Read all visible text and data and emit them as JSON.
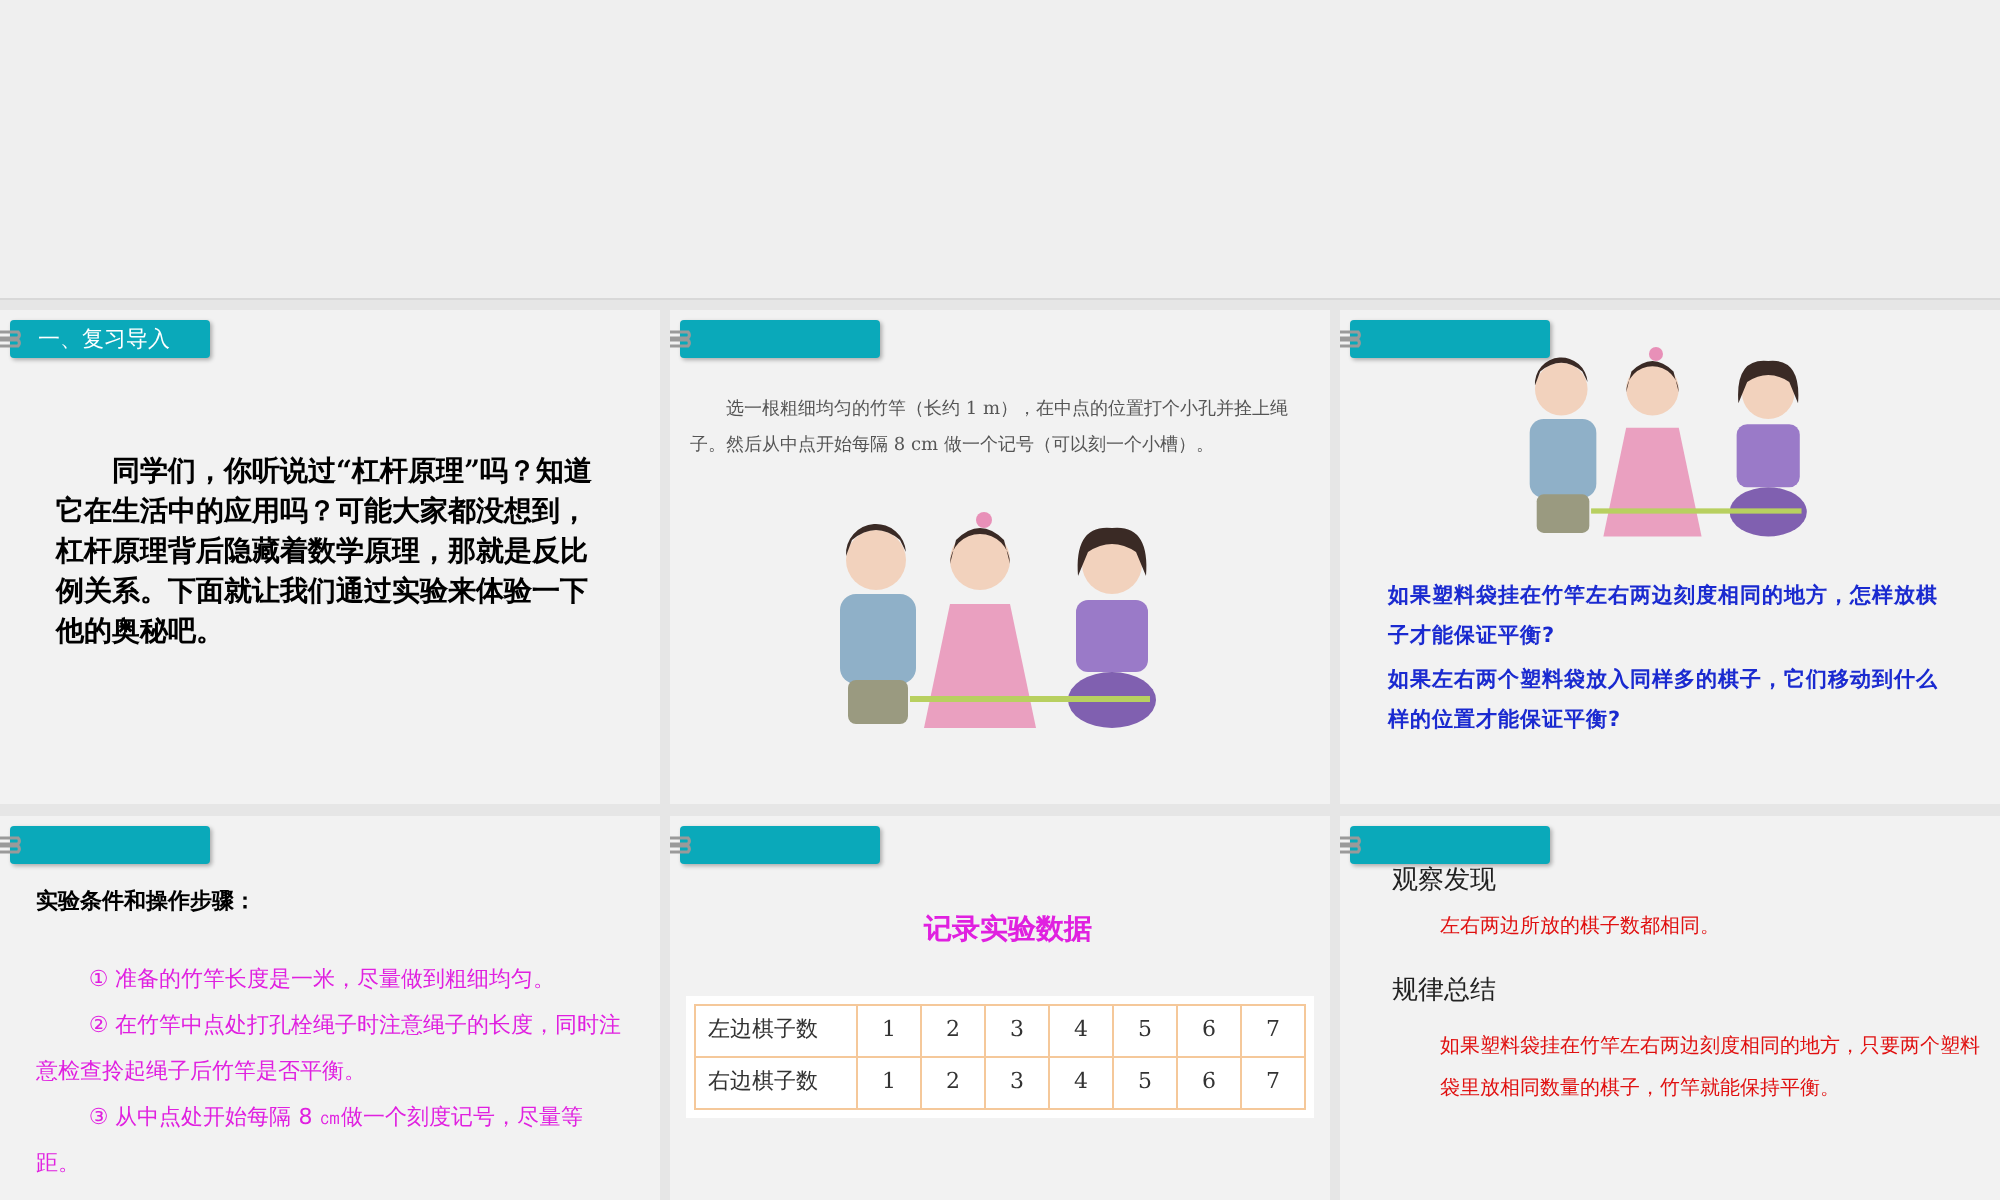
{
  "slides": [
    {
      "kind": "intro",
      "header": "一、复习导入",
      "paragraph": "同学们，你听说过“杠杆原理”吗？知道它在生活中的应用吗？可能大家都没想到，杠杆原理背后隐藏着数学原理，那就是反比例关系。下面就让我们通过实验来体验一下他的奥秘吧。"
    },
    {
      "kind": "text_picture",
      "paragraph": "选一根粗细均匀的竹竿（长约 1 m），在中点的位置打个小孔并拴上绳子。然后从中点开始每隔 8 cm 做一个记号（可以刻一个小槽）。"
    },
    {
      "kind": "picture_questions",
      "questions": [
        "如果塑料袋挂在竹竿左右两边刻度相同的地方，怎样放棋子才能保证平衡?",
        "如果左右两个塑料袋放入同样多的棋子，它们移动到什么样的位置才能保证平衡?"
      ]
    },
    {
      "kind": "steps",
      "heading": "实验条件和操作步骤：",
      "steps": [
        "① 准备的竹竿长度是一米，尽量做到粗细均匀。",
        "② 在竹竿中点处打孔栓绳子时注意绳子的长度，同时注意检查拎起绳子后竹竿是否平衡。",
        "③ 从中点处开始每隔 8 ㎝做一个刻度记号，尽量等距。"
      ]
    },
    {
      "kind": "table",
      "title": "记录实验数据",
      "rows": [
        {
          "label": "左边棋子数",
          "values": [
            "1",
            "2",
            "3",
            "4",
            "5",
            "6",
            "7"
          ]
        },
        {
          "label": "右边棋子数",
          "values": [
            "1",
            "2",
            "3",
            "4",
            "5",
            "6",
            "7"
          ]
        }
      ]
    },
    {
      "kind": "findings",
      "sections": [
        {
          "heading": "观察发现",
          "text": "左右两边所放的棋子数都相同。"
        },
        {
          "heading": "规律总结",
          "text": "如果塑料袋挂在竹竿左右两边刻度相同的地方，只要两个塑料袋里放相同数量的棋子，竹竿就能保持平衡。"
        }
      ]
    }
  ]
}
